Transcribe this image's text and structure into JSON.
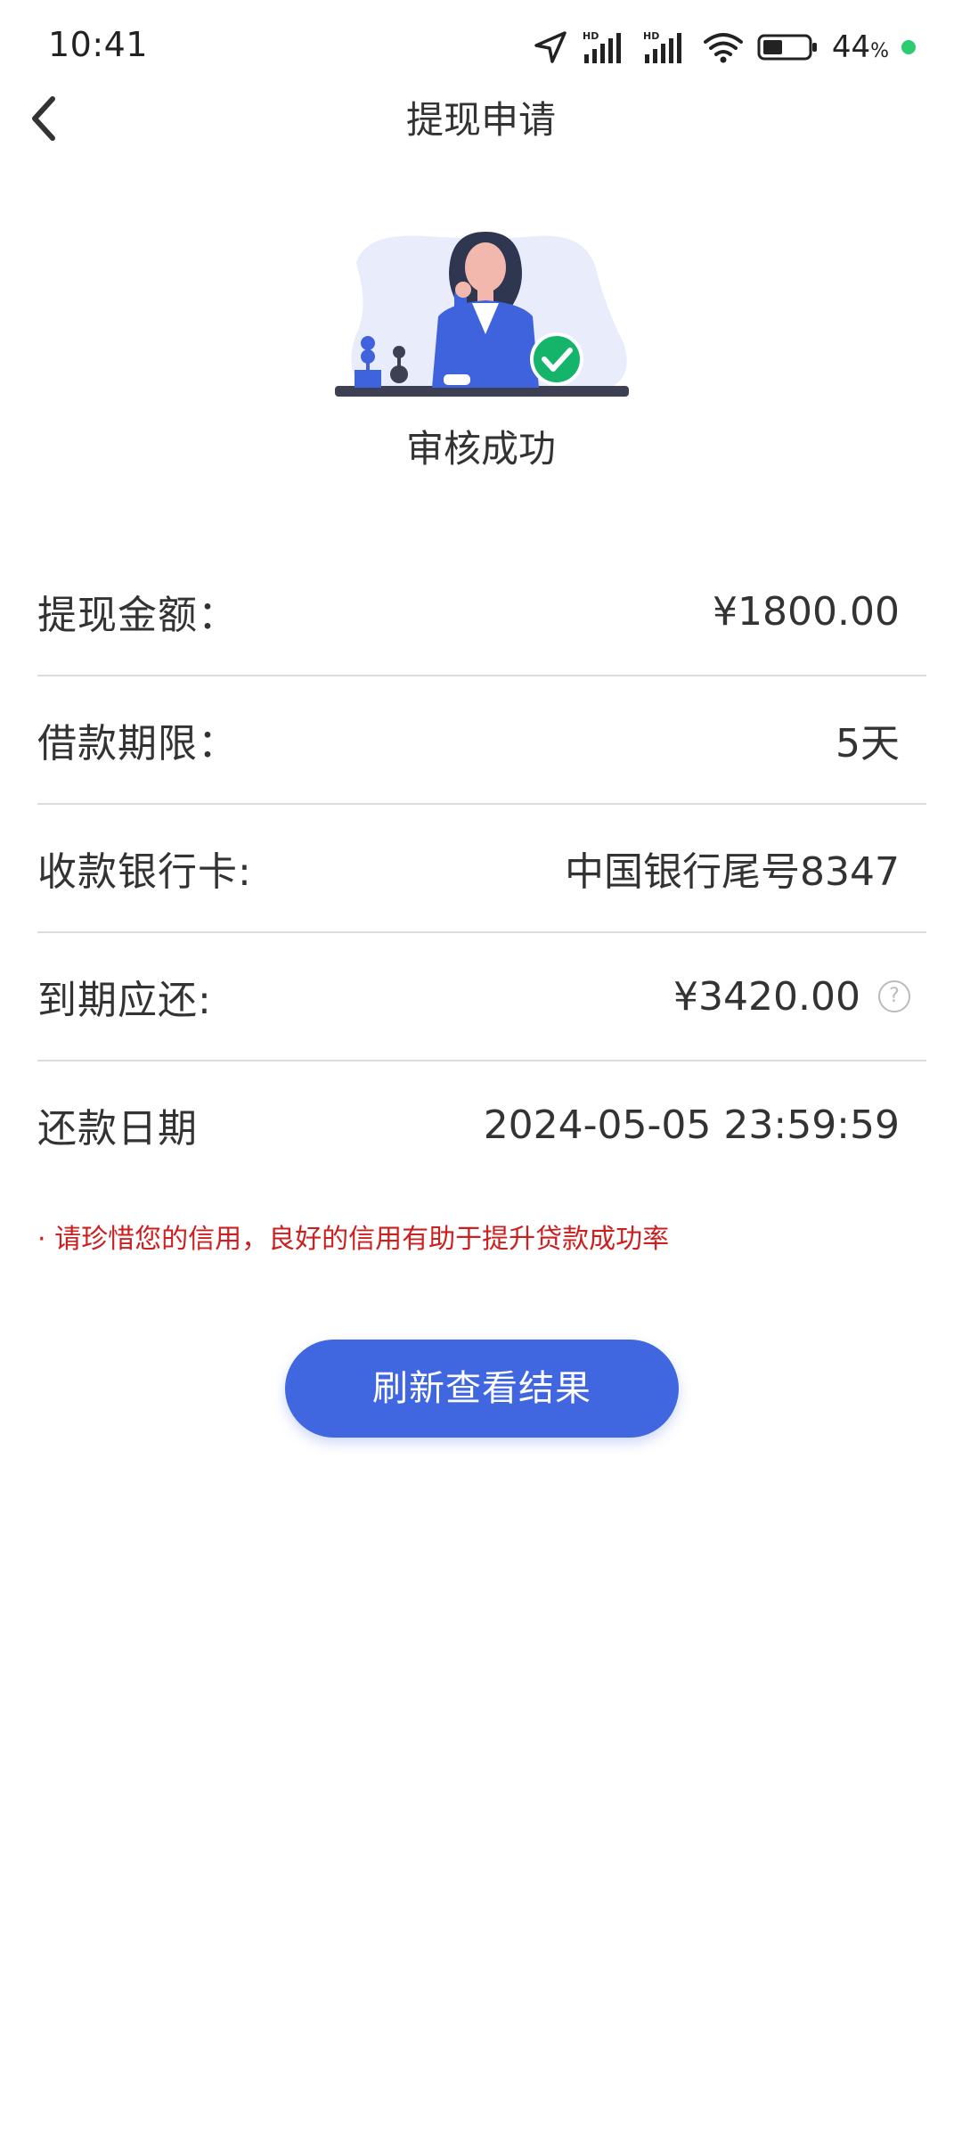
{
  "status_bar": {
    "time": "10:41",
    "battery_percent": "44",
    "battery_suffix": "%",
    "battery_level": 0.44,
    "icons": [
      "location-icon",
      "signal-hd-icon",
      "signal-hd-icon",
      "wifi-icon",
      "battery-icon"
    ],
    "dot_color": "#2ecc71"
  },
  "header": {
    "title": "提现申请",
    "back_icon": "chevron-left-icon"
  },
  "result": {
    "title": "审核成功",
    "status_icon": "check-circle-icon",
    "status_color": "#14b56a"
  },
  "details": [
    {
      "label": "提现金额：",
      "value": "¥1800.00"
    },
    {
      "label": "借款期限：",
      "value": "5天"
    },
    {
      "label": "收款银行卡:",
      "value": "中国银行尾号8347"
    },
    {
      "label": "到期应还:",
      "value": "¥3420.00",
      "help_icon": "?"
    },
    {
      "label": "还款日期",
      "value": "2024-05-05 23:59:59"
    }
  ],
  "notice": "· 请珍惜您的信用，良好的信用有助于提升贷款成功率",
  "notice_color": "#cc1f1f",
  "button": {
    "label": "刷新查看结果",
    "color": "#4066e0"
  }
}
